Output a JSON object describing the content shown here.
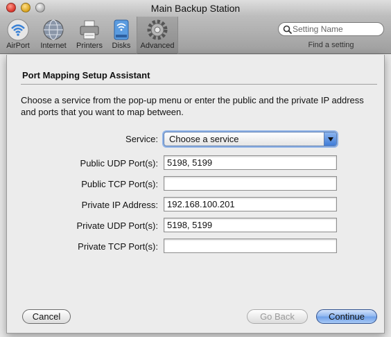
{
  "window": {
    "title": "Main Backup Station"
  },
  "toolbar": {
    "items": [
      {
        "label": "AirPort",
        "icon": "airport-icon"
      },
      {
        "label": "Internet",
        "icon": "globe-icon"
      },
      {
        "label": "Printers",
        "icon": "printer-icon"
      },
      {
        "label": "Disks",
        "icon": "disk-icon"
      },
      {
        "label": "Advanced",
        "icon": "gear-icon",
        "selected": true
      }
    ],
    "search": {
      "placeholder": "Setting Name",
      "hint": "Find a setting"
    }
  },
  "sheet": {
    "title": "Port Mapping Setup Assistant",
    "instructions": "Choose a service from the pop-up menu or enter the public and the private IP address and ports that you want to map between.",
    "service": {
      "label": "Service:",
      "selected": "Choose a service"
    },
    "fields": [
      {
        "label": "Public UDP Port(s):",
        "value": "5198, 5199"
      },
      {
        "label": "Public TCP Port(s):",
        "value": ""
      },
      {
        "label": "Private IP Address:",
        "value": "192.168.100.201"
      },
      {
        "label": "Private UDP Port(s):",
        "value": "5198, 5199"
      },
      {
        "label": "Private TCP Port(s):",
        "value": ""
      }
    ],
    "buttons": {
      "cancel": "Cancel",
      "back": "Go Back",
      "continue": "Continue"
    }
  },
  "colors": {
    "accent": "#6d9fe8",
    "window_bg": "#e8e8e8"
  }
}
